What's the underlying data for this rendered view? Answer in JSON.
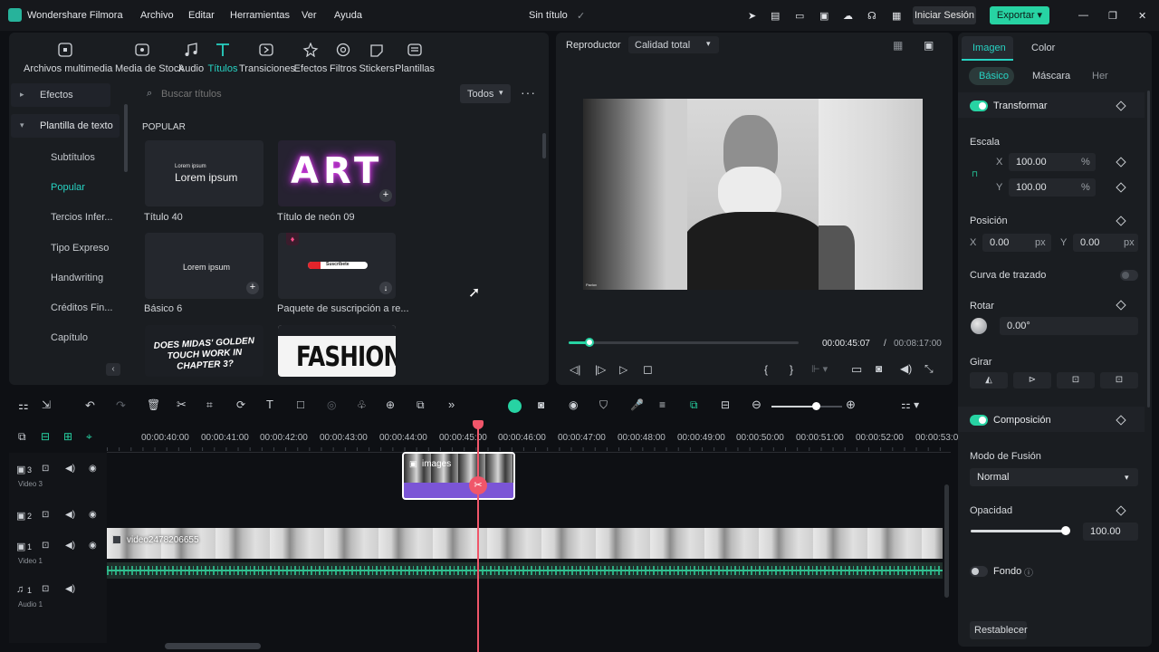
{
  "app": {
    "name": "Wondershare Filmora",
    "doc_title": "Sin título"
  },
  "menu": [
    "Archivo",
    "Editar",
    "Herramientas",
    "Ver",
    "Ayuda"
  ],
  "header": {
    "login": "Iniciar Sesión",
    "export": "Exportar"
  },
  "media_tabs": [
    {
      "label": "Archivos multimedia",
      "icon": "media-icon"
    },
    {
      "label": "Media de Stock",
      "icon": "stock-icon"
    },
    {
      "label": "Audio",
      "icon": "music-icon"
    },
    {
      "label": "Títulos",
      "icon": "text-icon"
    },
    {
      "label": "Transiciones",
      "icon": "transition-icon"
    },
    {
      "label": "Efectos",
      "icon": "effects-icon"
    },
    {
      "label": "Filtros",
      "icon": "filter-icon"
    },
    {
      "label": "Stickers",
      "icon": "sticker-icon"
    },
    {
      "label": "Plantillas",
      "icon": "template-icon"
    }
  ],
  "sidebar": {
    "effects": "Efectos",
    "text_template": "Plantilla de texto",
    "items": [
      "Subtítulos",
      "Popular",
      "Tercios Infer...",
      "Tipo Expreso",
      "Handwriting",
      "Créditos Fin...",
      "Capítulo"
    ]
  },
  "library": {
    "search_placeholder": "Buscar títulos",
    "filter": "Todos",
    "section": "POPULAR",
    "cards": [
      {
        "name": "Título 40",
        "preview_small": "Lorem ipsum",
        "preview_big": "Lorem ipsum"
      },
      {
        "name": "Título de neón 09",
        "preview_big": "ART"
      },
      {
        "name": "Básico 6",
        "preview_big": "Lorem ipsum"
      },
      {
        "name": "Paquete de suscripción a re...",
        "preview_big": "Suscríbete"
      },
      {
        "preview_big": "DOES MIDAS' GOLDEN TOUCH WORK IN CHAPTER 3?"
      },
      {
        "preview_big": "FASHION"
      }
    ]
  },
  "player": {
    "label": "Reproductor",
    "quality": "Calidad total",
    "current_time": "00:00:45:07",
    "total_time": "00:08:17:00",
    "progress": 0.09,
    "frame_caption": "Pavlov"
  },
  "properties": {
    "tabs": [
      "Imagen",
      "Color"
    ],
    "subtabs": [
      "Básico",
      "Máscara",
      "Her"
    ],
    "transform": "Transformar",
    "scale": "Escala",
    "scale_x_label": "X",
    "scale_x": "100.00",
    "scale_y_label": "Y",
    "scale_y": "100.00",
    "percent": "%",
    "position": "Posición",
    "pos_x_label": "X",
    "pos_x": "0.00",
    "pos_y_label": "Y",
    "pos_y": "0.00",
    "px": "px",
    "path_curve": "Curva de trazado",
    "rotate": "Rotar",
    "rotate_value": "0.00°",
    "flip": "Girar",
    "composition": "Composición",
    "blend_mode_label": "Modo de Fusión",
    "blend_mode": "Normal",
    "opacity_label": "Opacidad",
    "opacity": "100.00",
    "opacity_fraction": 1.0,
    "background": "Fondo",
    "reset": "Restablecer"
  },
  "timeline": {
    "ticks": [
      "00:00:40:00",
      "00:00:41:00",
      "00:00:42:00",
      "00:00:43:00",
      "00:00:44:00",
      "00:00:45:00",
      "00:00:46:00",
      "00:00:47:00",
      "00:00:48:00",
      "00:00:49:00",
      "00:00:50:00",
      "00:00:51:00",
      "00:00:52:00",
      "00:00:53:0"
    ],
    "tracks": [
      {
        "number": "3",
        "name": "Video 3"
      },
      {
        "number": "2",
        "name": ""
      },
      {
        "number": "1",
        "name": "Video 1"
      },
      {
        "number": "1",
        "name": "Audio 1"
      }
    ],
    "clip_image": "images",
    "clip_video": "video2478206655"
  },
  "colors": {
    "accent": "#27d3a3",
    "playhead": "#f0566a",
    "clip_purple": "#7b55d6",
    "audio_wave": "#2fbf8f"
  }
}
